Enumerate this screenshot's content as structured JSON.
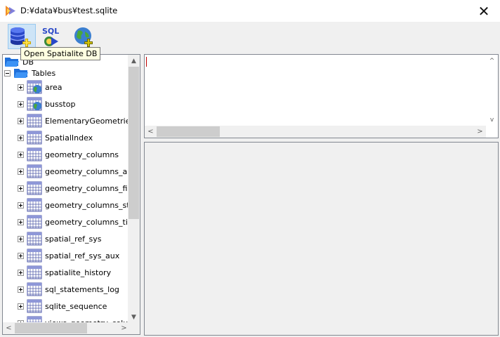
{
  "window": {
    "title": "D:¥data¥bus¥test.sqlite",
    "close_glyph": "✕",
    "app_icon": "spatialite-gui-icon"
  },
  "toolbar": {
    "buttons": [
      {
        "name": "open-spatialite-db-button",
        "icon": "database-add-icon",
        "pressed": true
      },
      {
        "name": "sql-execute-button",
        "icon": "sql-run-icon",
        "label": "SQL",
        "pressed": false
      },
      {
        "name": "globe-add-button",
        "icon": "globe-add-icon",
        "pressed": false
      }
    ],
    "tooltip": "Open Spatialite DB"
  },
  "tree": {
    "root_label": "DB",
    "tables_label": "Tables",
    "items": [
      {
        "label": "area",
        "geometry": true
      },
      {
        "label": "busstop",
        "geometry": true
      },
      {
        "label": "ElementaryGeometries",
        "geometry": false
      },
      {
        "label": "SpatialIndex",
        "geometry": false
      },
      {
        "label": "geometry_columns",
        "geometry": false
      },
      {
        "label": "geometry_columns_auth",
        "geometry": false
      },
      {
        "label": "geometry_columns_field_infos",
        "geometry": false
      },
      {
        "label": "geometry_columns_statistics",
        "geometry": false
      },
      {
        "label": "geometry_columns_time",
        "geometry": false
      },
      {
        "label": "spatial_ref_sys",
        "geometry": false
      },
      {
        "label": "spatial_ref_sys_aux",
        "geometry": false
      },
      {
        "label": "spatialite_history",
        "geometry": false
      },
      {
        "label": "sql_statements_log",
        "geometry": false
      },
      {
        "label": "sqlite_sequence",
        "geometry": false
      },
      {
        "label": "views_geometry_columns",
        "geometry": false
      }
    ]
  },
  "colors": {
    "folder_blue": "#1e6fd9",
    "table_border": "#4f5aa8",
    "tooltip_bg": "#ffffe1"
  }
}
